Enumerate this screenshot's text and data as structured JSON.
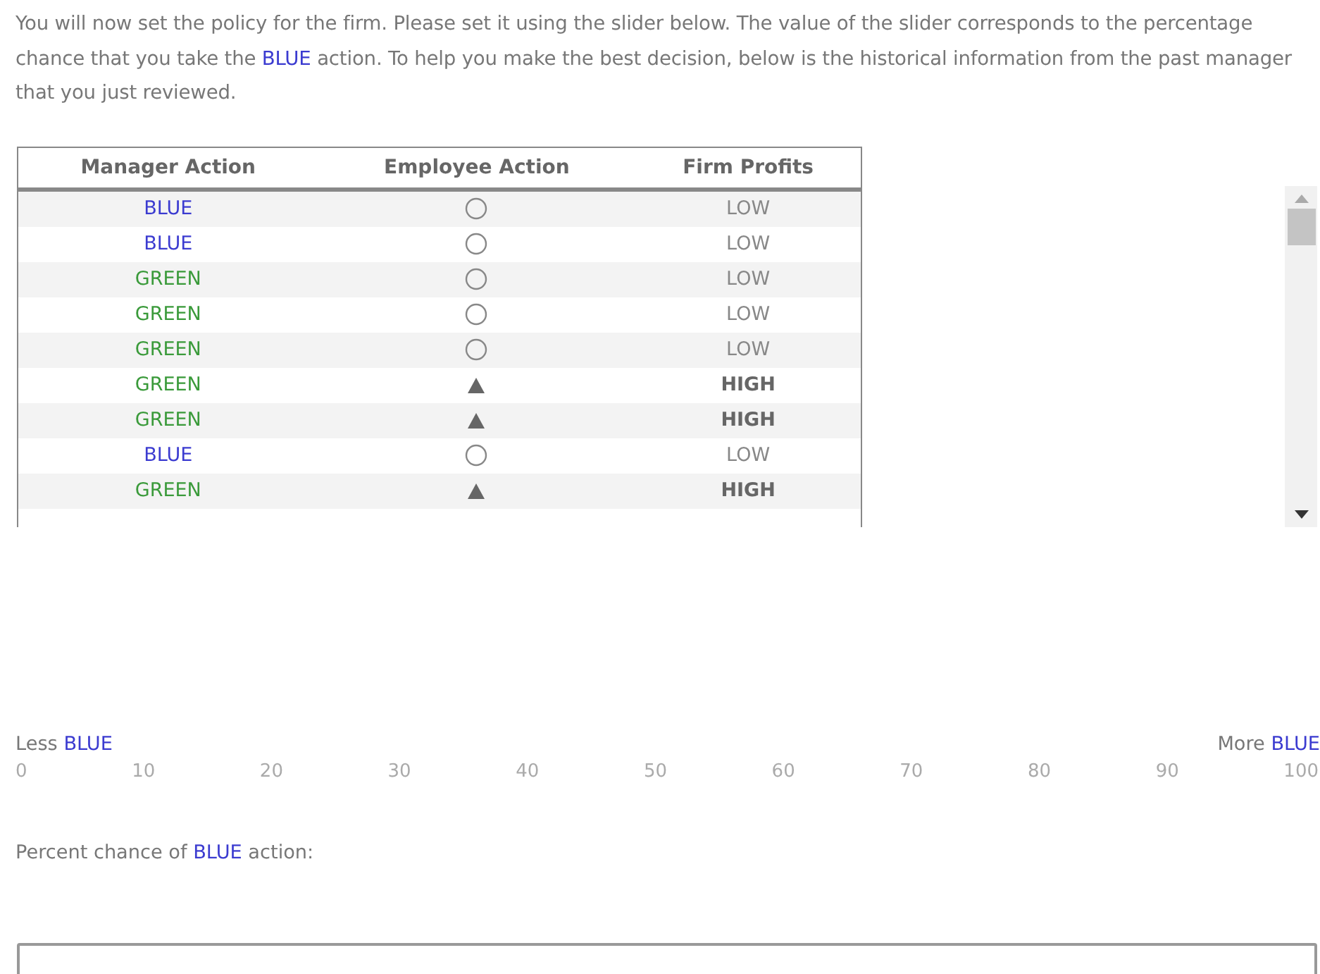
{
  "intro": [
    {
      "kind": "plain",
      "text": "You will now set the policy for the firm. Please set it using the slider below. The value of the slider corresponds to the percentage chance that you take the "
    },
    {
      "kind": "blue",
      "text": "BLUE"
    },
    {
      "kind": "plain",
      "text": " action. To help you make the best decision, below is the historical information from the past manager that you just reviewed."
    }
  ],
  "table": {
    "columns": [
      "Manager Action",
      "Employee Action",
      "Firm Profits"
    ],
    "rows": [
      {
        "manager": {
          "kind": "blue",
          "text": "BLUE"
        },
        "employee": {
          "kind": "circle"
        },
        "profits": {
          "kind": "low",
          "text": "LOW"
        }
      },
      {
        "manager": {
          "kind": "blue",
          "text": "BLUE"
        },
        "employee": {
          "kind": "circle"
        },
        "profits": {
          "kind": "low",
          "text": "LOW"
        }
      },
      {
        "manager": {
          "kind": "green",
          "text": "GREEN"
        },
        "employee": {
          "kind": "circle"
        },
        "profits": {
          "kind": "low",
          "text": "LOW"
        }
      },
      {
        "manager": {
          "kind": "green",
          "text": "GREEN"
        },
        "employee": {
          "kind": "circle"
        },
        "profits": {
          "kind": "low",
          "text": "LOW"
        }
      },
      {
        "manager": {
          "kind": "green",
          "text": "GREEN"
        },
        "employee": {
          "kind": "circle"
        },
        "profits": {
          "kind": "low",
          "text": "LOW"
        }
      },
      {
        "manager": {
          "kind": "green",
          "text": "GREEN"
        },
        "employee": {
          "kind": "triangle"
        },
        "profits": {
          "kind": "high",
          "text": "HIGH"
        }
      },
      {
        "manager": {
          "kind": "green",
          "text": "GREEN"
        },
        "employee": {
          "kind": "triangle"
        },
        "profits": {
          "kind": "high",
          "text": "HIGH"
        }
      },
      {
        "manager": {
          "kind": "blue",
          "text": "BLUE"
        },
        "employee": {
          "kind": "circle"
        },
        "profits": {
          "kind": "low",
          "text": "LOW"
        }
      },
      {
        "manager": {
          "kind": "green",
          "text": "GREEN"
        },
        "employee": {
          "kind": "triangle"
        },
        "profits": {
          "kind": "high",
          "text": "HIGH"
        }
      }
    ]
  },
  "slider": {
    "left_label": [
      {
        "kind": "plain",
        "text": "Less "
      },
      {
        "kind": "blue",
        "text": "BLUE"
      }
    ],
    "right_label": [
      {
        "kind": "plain",
        "text": "More "
      },
      {
        "kind": "blue",
        "text": "BLUE"
      }
    ],
    "ticks": [
      "0",
      "10",
      "20",
      "30",
      "40",
      "50",
      "60",
      "70",
      "80",
      "90",
      "100"
    ]
  },
  "percent_label": [
    {
      "kind": "plain",
      "text": "Percent chance of "
    },
    {
      "kind": "blue",
      "text": "BLUE"
    },
    {
      "kind": "plain",
      "text": " action:"
    }
  ]
}
